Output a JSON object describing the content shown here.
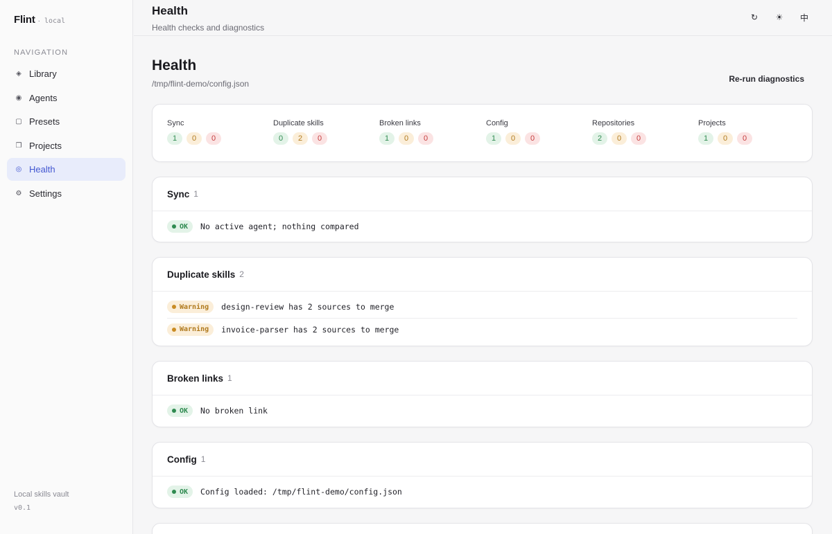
{
  "brand": {
    "name": "Flint",
    "dot": "·",
    "tag": "local"
  },
  "nav": {
    "heading": "NAVIGATION",
    "items": [
      {
        "label": "Library",
        "icon": "diamond-icon"
      },
      {
        "label": "Agents",
        "icon": "target-icon"
      },
      {
        "label": "Presets",
        "icon": "square-icon"
      },
      {
        "label": "Projects",
        "icon": "copy-icon"
      },
      {
        "label": "Health",
        "icon": "ring-icon"
      },
      {
        "label": "Settings",
        "icon": "gear-icon"
      }
    ],
    "active": "Health"
  },
  "sidebar_footer": {
    "line1": "Local skills vault",
    "version": "v0.1"
  },
  "topbar": {
    "title": "Health",
    "subtitle": "Health checks and diagnostics",
    "icons": [
      "refresh-icon",
      "theme-icon",
      "language-icon"
    ]
  },
  "page": {
    "title": "Health",
    "path": "/tmp/flint-demo/config.json",
    "rerun_label": "Re-run diagnostics"
  },
  "summary": [
    {
      "label": "Sync",
      "ok": "1",
      "warn": "0",
      "err": "0"
    },
    {
      "label": "Duplicate skills",
      "ok": "0",
      "warn": "2",
      "err": "0"
    },
    {
      "label": "Broken links",
      "ok": "1",
      "warn": "0",
      "err": "0"
    },
    {
      "label": "Config",
      "ok": "1",
      "warn": "0",
      "err": "0"
    },
    {
      "label": "Repositories",
      "ok": "2",
      "warn": "0",
      "err": "0"
    },
    {
      "label": "Projects",
      "ok": "1",
      "warn": "0",
      "err": "0"
    }
  ],
  "sections": [
    {
      "title": "Sync",
      "count": "1",
      "rows": [
        {
          "status": "OK",
          "message": "No active agent; nothing compared"
        }
      ]
    },
    {
      "title": "Duplicate skills",
      "count": "2",
      "rows": [
        {
          "status": "Warning",
          "message": "design-review has 2 sources to merge"
        },
        {
          "status": "Warning",
          "message": "invoice-parser has 2 sources to merge"
        }
      ]
    },
    {
      "title": "Broken links",
      "count": "1",
      "rows": [
        {
          "status": "OK",
          "message": "No broken link"
        }
      ]
    },
    {
      "title": "Config",
      "count": "1",
      "rows": [
        {
          "status": "OK",
          "message": "Config loaded: /tmp/flint-demo/config.json"
        }
      ]
    }
  ],
  "colors": {
    "accent": "#4257d1",
    "ok": "#2f8a50",
    "warn": "#b07a1e",
    "error": "#c43d3d"
  }
}
